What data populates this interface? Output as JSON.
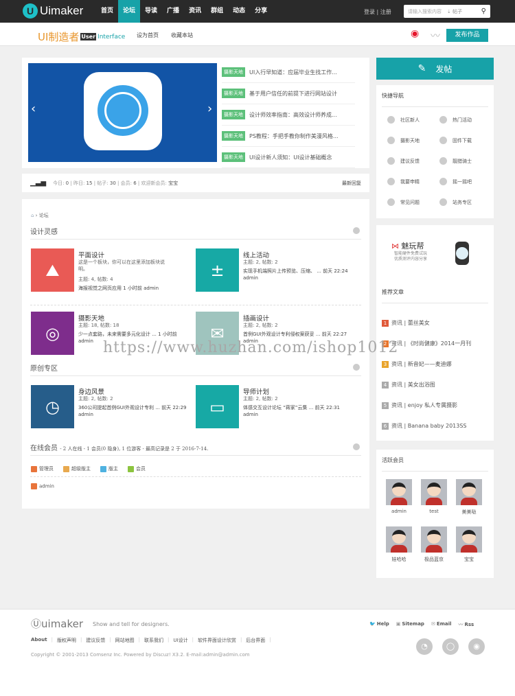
{
  "header": {
    "logo": "Uimaker",
    "nav": [
      "首页",
      "论坛",
      "导读",
      "广播",
      "资讯",
      "群组",
      "动态",
      "分享"
    ],
    "active_nav": 1,
    "login": "登录",
    "register": "注册",
    "search_placeholder": "请输入搜索内容",
    "search_scope": "帖子"
  },
  "subheader": {
    "brand": "UI制造者",
    "brand_user": "User",
    "brand_interface": "Interface",
    "set_home": "设为首页",
    "bookmark": "收藏本站",
    "publish": "发布作品"
  },
  "slider": {
    "news": [
      {
        "tag": "摄影天地",
        "title": "UI入行早知道：应届毕业生找工作..."
      },
      {
        "tag": "摄影天地",
        "title": "基于用户信任的前提下进行网站设计"
      },
      {
        "tag": "摄影天地",
        "title": "设计师效率指南：高效设计师养成..."
      },
      {
        "tag": "摄影天地",
        "title": "PS教程：手把手教你制作美漫风格..."
      },
      {
        "tag": "摄影天地",
        "title": "UI设计新人须知：UI设计基础概念"
      }
    ]
  },
  "stats": {
    "today_label": "今日:",
    "today": "0",
    "yesterday_label": "昨日:",
    "yesterday": "15",
    "posts_label": "帖子:",
    "posts": "30",
    "members_label": "会员:",
    "members": "6",
    "welcome_label": "欢迎新会员:",
    "newest": "宝宝",
    "latest_reply": "最新回复"
  },
  "forum": {
    "breadcrumb": "论坛",
    "sections": [
      {
        "title": "设计灵感",
        "boards": [
          {
            "name": "平面设计",
            "desc": "这是一个板块，你可以在这里添加板块说明。",
            "counts": "主题: 4, 帖数: 4",
            "last": "海报视觉之网页应用 1 小时前 admin",
            "color": "#e95a55"
          },
          {
            "name": "线上活动",
            "counts": "主题: 2, 帖数: 2",
            "last": "实现手机端照片上传预览、压缩、 ... 前天 22:24",
            "author": "admin",
            "color": "#17a9a5"
          },
          {
            "name": "摄影天地",
            "counts": "主题: 18, 帖数: 18",
            "last": "少一点套路，未来需要多元化设计 ... 1 小时前",
            "author": "admin",
            "color": "#7e2d8c"
          },
          {
            "name": "插画设计",
            "counts": "主题: 2, 帖数: 2",
            "last": "首例GUI外观设计专利侵权案获妥 ... 前天 22:27",
            "author": "admin",
            "color": "#9fc4be"
          }
        ]
      },
      {
        "title": "原创专区",
        "boards": [
          {
            "name": "身边风景",
            "counts": "主题: 2, 帖数: 2",
            "last": "360公司提起首例GUI外观设计专利 ... 前天 22:29",
            "author": "admin",
            "color": "#265d8a"
          },
          {
            "name": "导师计划",
            "counts": "主题: 2, 帖数: 2",
            "last": "体感交互设计论坛 “蒋家”云集 ... 前天 22:31",
            "author": "admin",
            "color": "#17a9a5"
          }
        ]
      }
    ],
    "online": {
      "title": "在线会员",
      "summary": "- 2 人在线 - 1 会员(0 隐身), 1 位游客 - 最高记录是 2 于 2016-7-14.",
      "legend": [
        {
          "label": "管理员",
          "color": "#e8743b"
        },
        {
          "label": "超级版主",
          "color": "#e8a94f"
        },
        {
          "label": "版主",
          "color": "#4fb2e0"
        },
        {
          "label": "会员",
          "color": "#8cc43f"
        }
      ],
      "users": [
        "admin"
      ]
    }
  },
  "sidebar": {
    "post": "发帖",
    "quicknav_title": "快捷导航",
    "quicknav": [
      "社区新人",
      "热门活动",
      "摄影天地",
      "固件下载",
      "建议反馈",
      "靓猎骑士",
      "我要申精",
      "摇一摇吧",
      "常见问题",
      "站务专区"
    ],
    "ad": {
      "brand": "魅玩帮",
      "line1": "智能硬件免费试玩",
      "line2": "优质测评内容分享"
    },
    "rec_title": "推荐文章",
    "rec": [
      "资讯 | 蕾丝美女",
      "资讯 | 《时尚健康》2014一月刊",
      "资讯 | 新音妃——麦迪娜",
      "资讯 | 美女出浴图",
      "资讯 | enjoy 私人专属摄影",
      "资讯 | Banana baby 2013SS"
    ],
    "rec_colors": [
      "#e05a3a",
      "#e8742b",
      "#e9a42b",
      "#aaaaaa",
      "#aaaaaa",
      "#aaaaaa"
    ],
    "active_title": "活跃会员",
    "active": [
      "admin",
      "test",
      "美美哒",
      "娃哈哈",
      "极品蓝京",
      "宝宝"
    ]
  },
  "footer": {
    "logo": "uimaker",
    "slogan": "Show and tell for designers.",
    "links": [
      "About",
      "版权声明",
      "建议反馈",
      "网站地图",
      "联系我们",
      "UI设计",
      "软件界面设计欣赏",
      "后台界面"
    ],
    "right": [
      "Help",
      "Sitemap",
      "Email",
      "Rss"
    ],
    "copyright": "Copyright © 2001-2013 Comsenz Inc. Powered by Discuz! X3.2. E-mail:admin@admin.com"
  },
  "watermark": "https://www.huzhan.com/ishop1012",
  "colors": {
    "accent": "#17a2a8",
    "topbar": "#2a2a2a"
  }
}
